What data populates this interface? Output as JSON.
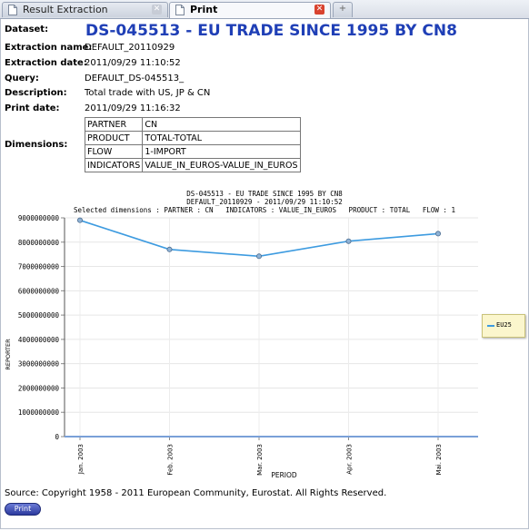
{
  "tabs": [
    {
      "label": "Result Extraction",
      "active": false
    },
    {
      "label": "Print",
      "active": true
    }
  ],
  "meta": {
    "dataset_key": "Dataset:",
    "dataset_value": "DS-045513 - EU TRADE SINCE 1995 BY CN8",
    "extraction_name_key": "Extraction name:",
    "extraction_name_value": "DEFAULT_20110929",
    "extraction_date_key": "Extraction date:",
    "extraction_date_value": "2011/09/29 11:10:52",
    "query_key": "Query:",
    "query_value": "DEFAULT_DS-045513_",
    "description_key": "Description:",
    "description_value": "Total trade with US, JP & CN",
    "print_date_key": "Print date:",
    "print_date_value": "2011/09/29 11:16:32",
    "dimensions_key": "Dimensions:"
  },
  "dimensions": [
    {
      "key": "PARTNER",
      "value": "CN"
    },
    {
      "key": "PRODUCT",
      "value": "TOTAL-TOTAL"
    },
    {
      "key": "FLOW",
      "value": "1-IMPORT"
    },
    {
      "key": "INDICATORS",
      "value": "VALUE_IN_EUROS-VALUE_IN_EUROS"
    }
  ],
  "chart_data": {
    "type": "line",
    "title_lines": [
      "DS-045513 - EU TRADE SINCE 1995 BY CN8",
      "DEFAULT_20110929 - 2011/09/29 11:10:52",
      "Selected dimensions : PARTNER : CN   INDICATORS : VALUE_IN_EUROS   PRODUCT : TOTAL   FLOW : 1"
    ],
    "xlabel": "PERIOD",
    "ylabel": "REPORTER",
    "categories": [
      "Jan. 2003",
      "Feb. 2003",
      "Mar. 2003",
      "Apr. 2003",
      "Mai. 2003"
    ],
    "series": [
      {
        "name": "EU25",
        "values": [
          8900000000,
          7700000000,
          7420000000,
          8040000000,
          8350000000
        ],
        "color": "#3d9be0"
      }
    ],
    "ylim": [
      0,
      9000000000
    ],
    "yticks": [
      "0",
      "1000000000",
      "2000000000",
      "3000000000",
      "4000000000",
      "5000000000",
      "6000000000",
      "7000000000",
      "8000000000",
      "9000000000"
    ],
    "grid": true,
    "legend_position": "right"
  },
  "source_text": "Source: Copyright 1958 - 2011 European Community, Eurostat. All Rights Reserved.",
  "print_button_label": "Print",
  "colors": {
    "title_blue": "#1f3fb6",
    "series_blue": "#3d9be0",
    "tab_close_red": "#d9432f"
  }
}
